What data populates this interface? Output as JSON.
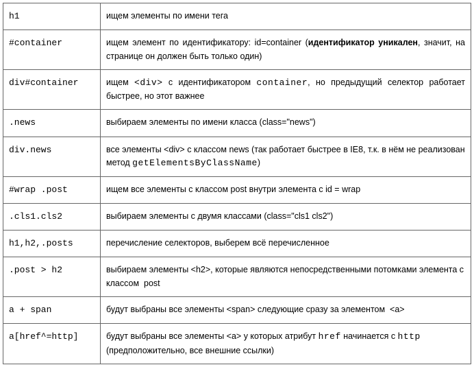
{
  "rows": [
    {
      "selector": "h1",
      "desc": "ищем элементы по имени тега",
      "justify": false
    },
    {
      "selector": "#container",
      "desc": "ищем элемент по идентификатору: id=container (<b>идентификатор уникален</b>, значит, на странице он должен быть только один)",
      "justify": true
    },
    {
      "selector": "div#container",
      "desc": "ищем <span class='mono'>&lt;div&gt;</span> с идентификатором <span class='mono'>container</span>, но предыдущий селектор работает быстрее, но этот важнее",
      "justify": true
    },
    {
      "selector": ".news",
      "desc": "выбираем элементы по имени класса (class=\"news\")",
      "justify": false
    },
    {
      "selector": "div.news",
      "desc": "все элементы &lt;div&gt; с классом news (так работает быстрее в IE8, т.к. в нём не реализован метод <span class='mono'>getElementsByClassName</span>)",
      "justify": false
    },
    {
      "selector": "#wrap .post",
      "desc": "ищем все элементы с классом post внутри элемента с id = wrap",
      "justify": false
    },
    {
      "selector": ".cls1.cls2",
      "desc": "выбираем элементы с двумя классами (class=\"cls1 cls2\")",
      "justify": false
    },
    {
      "selector": "h1,h2,.posts",
      "desc": "перечисление селекторов, выберем всё перечисленное",
      "justify": false
    },
    {
      "selector": ".post > h2",
      "desc": "выбираем элементы &lt;h2&gt;, которые являются непосредственными потомками элемента с классом &nbsp;post",
      "justify": false
    },
    {
      "selector": "a + span",
      "desc": "будут выбраны все элементы &lt;span&gt; следующие сразу за элементом &nbsp;&lt;a&gt;",
      "justify": false
    },
    {
      "selector": "a[href^=http]",
      "desc": "будут выбраны все элементы &lt;a&gt; у которых атрибут <span class='mono'>href</span> начинается с <span class='mono'>http</span> (предположительно, все внешние ссылки)",
      "justify": false
    }
  ]
}
